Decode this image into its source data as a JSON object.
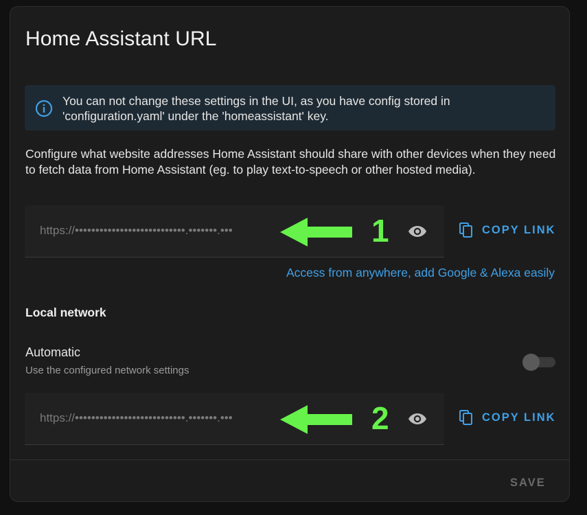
{
  "dialog": {
    "title": "Home Assistant URL"
  },
  "alert": {
    "icon": "info-icon",
    "text": "You can not change these settings in the UI, as you have config stored in 'configuration.yaml' under the 'homeassistant' key."
  },
  "description": "Configure what website addresses Home Assistant should share with other devices when they need to fetch data from Home Assistant (eg. to play text-to-speech or other hosted media).",
  "external_url": {
    "value": "https://•••••••••••••••••••••••••••.•••••••.•••",
    "annotation_number": "1",
    "copy_label": "COPY LINK"
  },
  "cloud_link": "Access from anywhere, add Google & Alexa easily",
  "local_network": {
    "heading": "Local network",
    "automatic_label": "Automatic",
    "automatic_sub": "Use the configured network settings",
    "automatic_enabled": false,
    "internal_url": {
      "value": "https://•••••••••••••••••••••••••••.•••••••.•••",
      "annotation_number": "2",
      "copy_label": "COPY LINK"
    }
  },
  "footer": {
    "save_label": "SAVE"
  },
  "colors": {
    "accent": "#3fa0e6",
    "annotation": "#66f24a",
    "background": "#1c1c1c"
  }
}
